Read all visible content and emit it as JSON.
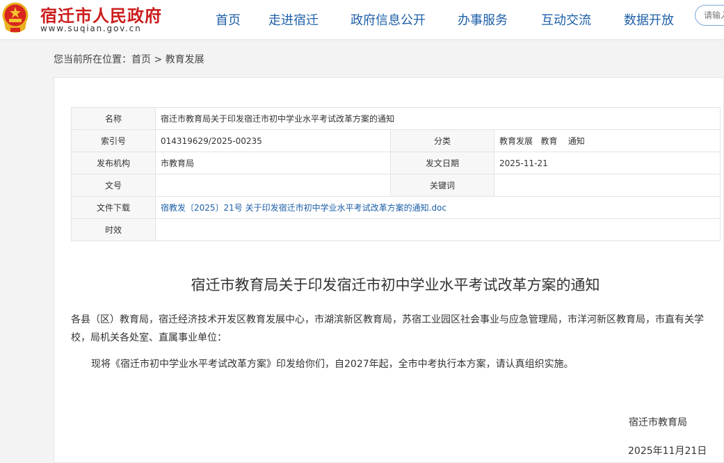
{
  "header": {
    "site_name": "宿迁市人民政府",
    "site_url": "www.suqian.gov.cn",
    "emblem_icon": "national-emblem-icon",
    "brand_color": "#cc1d1d",
    "nav_color": "#1e5fa8",
    "nav": [
      {
        "label": "首页"
      },
      {
        "label": "走进宿迁"
      },
      {
        "label": "政府信息公开"
      },
      {
        "label": "办事服务"
      },
      {
        "label": "互动交流"
      },
      {
        "label": "数据开放"
      }
    ],
    "search_placeholder": "请输入"
  },
  "breadcrumb": {
    "prefix": "您当前所在位置：",
    "home": "首页",
    "separator": " > ",
    "current": "教育发展"
  },
  "meta": {
    "name_label": "名称",
    "name_value": "宿迁市教育局关于印发宿迁市初中学业水平考试改革方案的通知",
    "index_label": "索引号",
    "index_value": "014319629/2025-00235",
    "category_label": "分类",
    "category_value": "教育发展   教育    通知",
    "publisher_label": "发布机构",
    "publisher_value": "市教育局",
    "date_label": "发文日期",
    "date_value": "2025-11-21",
    "docno_label": "文号",
    "docno_value": "",
    "keywords_label": "关键词",
    "keywords_value": "",
    "download_label": "文件下载",
    "download_value": "宿教发〔2025〕21号 关于印发宿迁市初中学业水平考试改革方案的通知.doc",
    "validity_label": "时效",
    "validity_value": ""
  },
  "article": {
    "title": "宿迁市教育局关于印发宿迁市初中学业水平考试改革方案的通知",
    "addressee": "各县（区）教育局，宿迁经济技术开发区教育发展中心，市湖滨新区教育局，苏宿工业园区社会事业与应急管理局，市洋河新区教育局，市直有关学校，局机关各处室、直属事业单位：",
    "body": "现将《宿迁市初中学业水平考试改革方案》印发给你们，自2027年起，全市中考执行本方案，请认真组织实施。",
    "signature": "宿迁市教育局",
    "sign_date": "2025年11月21日"
  }
}
